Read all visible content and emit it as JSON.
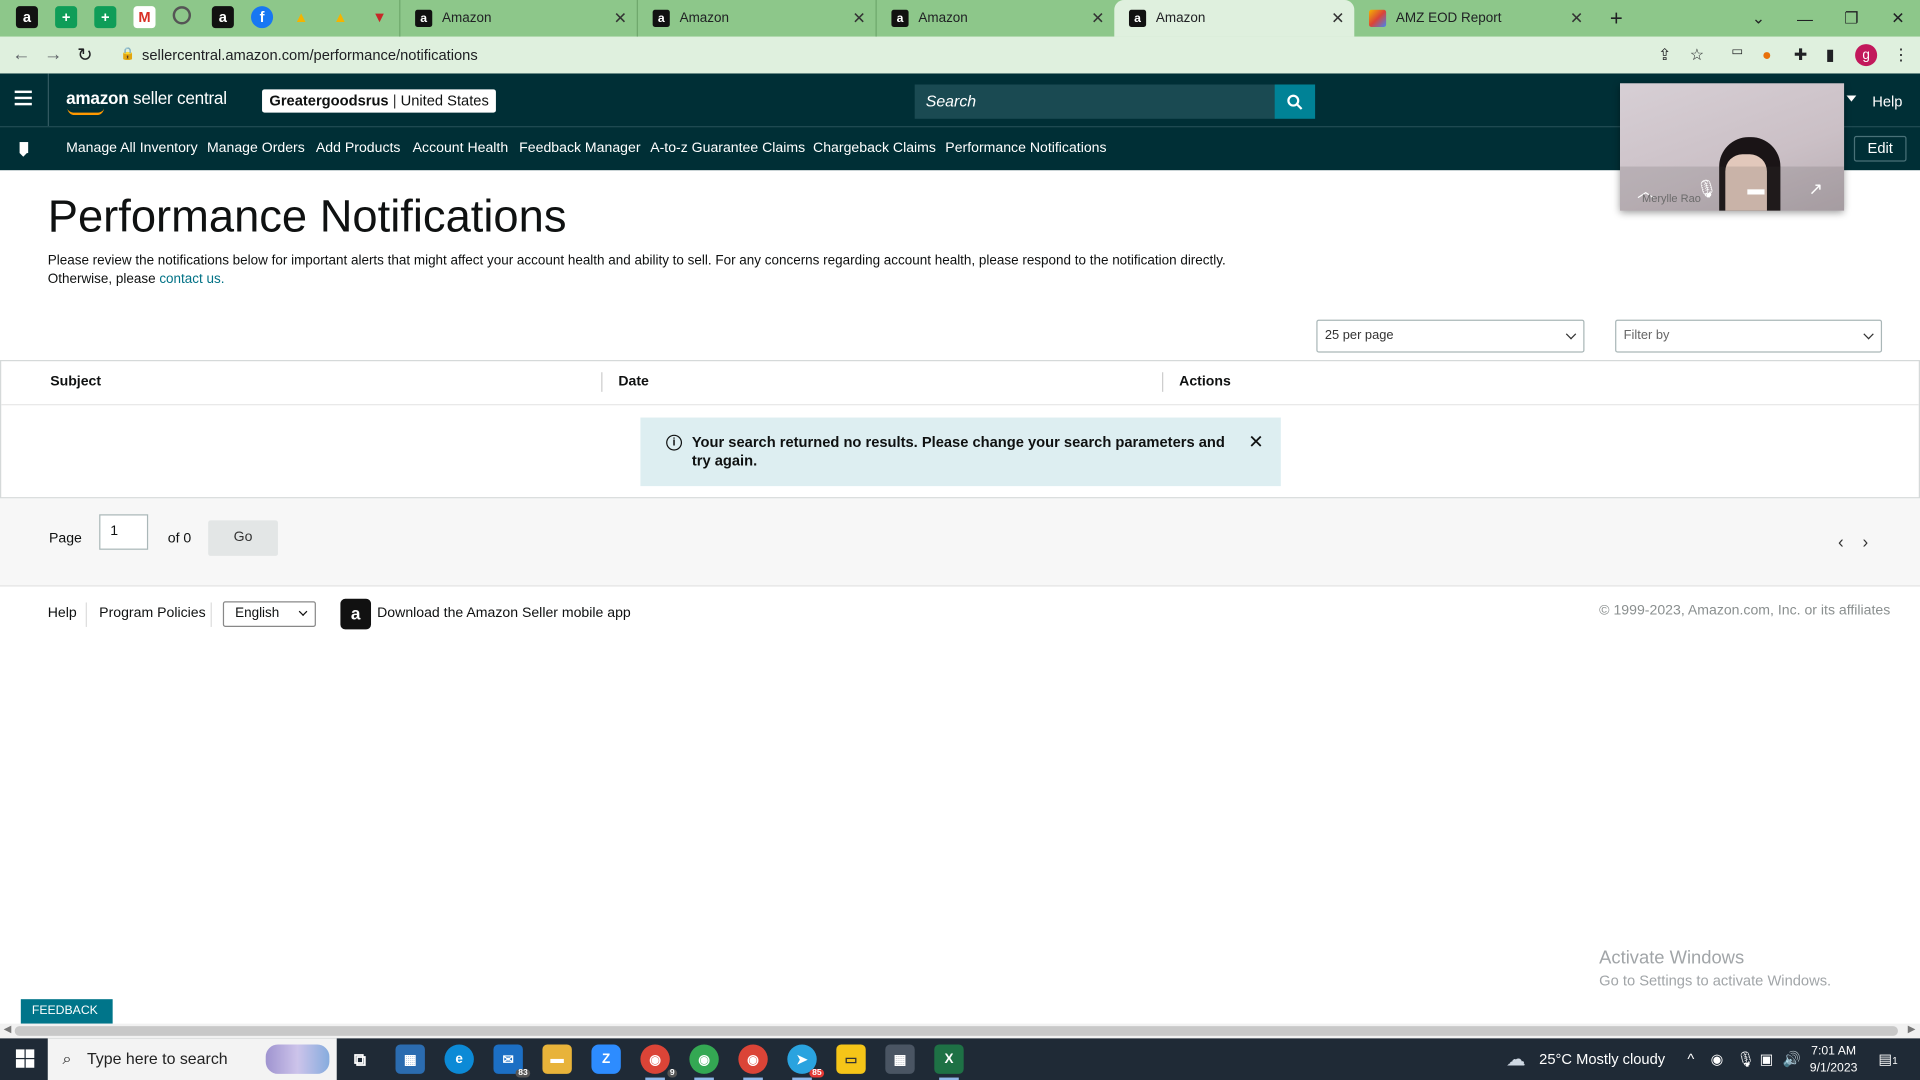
{
  "browser": {
    "tabs": [
      {
        "title": "Amazon",
        "active": false
      },
      {
        "title": "Amazon",
        "active": false
      },
      {
        "title": "Amazon",
        "active": false
      },
      {
        "title": "Amazon",
        "active": true
      },
      {
        "title": "AMZ EOD Report",
        "active": false
      }
    ],
    "url": "sellercentral.amazon.com/performance/notifications",
    "profile_initial": "g"
  },
  "header": {
    "logo_text": "amazon",
    "logo_suffix": "seller central",
    "store_name": "Greatergoodsrus",
    "store_region": "United States",
    "search_placeholder": "Search",
    "help_label": "Help"
  },
  "nav": {
    "items": [
      "Manage All Inventory",
      "Manage Orders",
      "Add Products",
      "Account Health",
      "Feedback Manager",
      "A-to-z Guarantee Claims",
      "Chargeback Claims",
      "Performance Notifications"
    ],
    "edit_label": "Edit"
  },
  "video_call": {
    "participant_name": "Merylle Rao"
  },
  "page": {
    "title": "Performance Notifications",
    "description": "Please review the notifications below for important alerts that might affect your account health and ability to sell. For any concerns regarding account health, please respond to the notification directly. Otherwise, please",
    "contact_link": "contact us.",
    "per_page": "25 per page",
    "filter_placeholder": "Filter by"
  },
  "table": {
    "columns": [
      "Subject",
      "Date",
      "Actions"
    ],
    "empty_message": "Your search returned no results. Please change your search parameters and try again."
  },
  "pagination": {
    "page_label": "Page",
    "current_page": "1",
    "of_label": "of 0",
    "go_label": "Go"
  },
  "footer": {
    "help": "Help",
    "program_policies": "Program Policies",
    "language": "English",
    "app_download": "Download the Amazon Seller mobile app",
    "copyright": "© 1999-2023, Amazon.com, Inc. or its affiliates"
  },
  "windows_activation": {
    "title": "Activate Windows",
    "subtitle": "Go to Settings to activate Windows."
  },
  "feedback_tab": {
    "label": "FEEDBACK"
  },
  "taskbar": {
    "search_placeholder": "Type here to search",
    "mail_badge": "83",
    "chrome_badge": "9",
    "telegram_badge": "85",
    "weather": "25°C  Mostly cloudy",
    "time": "7:01 AM",
    "date": "9/1/2023",
    "notif_count": "1"
  },
  "colors": {
    "header_bg": "#002f36",
    "accent_teal": "#008296",
    "link": "#007185",
    "alert_bg": "#ddeef1",
    "tab_strip": "#8dc78a"
  }
}
